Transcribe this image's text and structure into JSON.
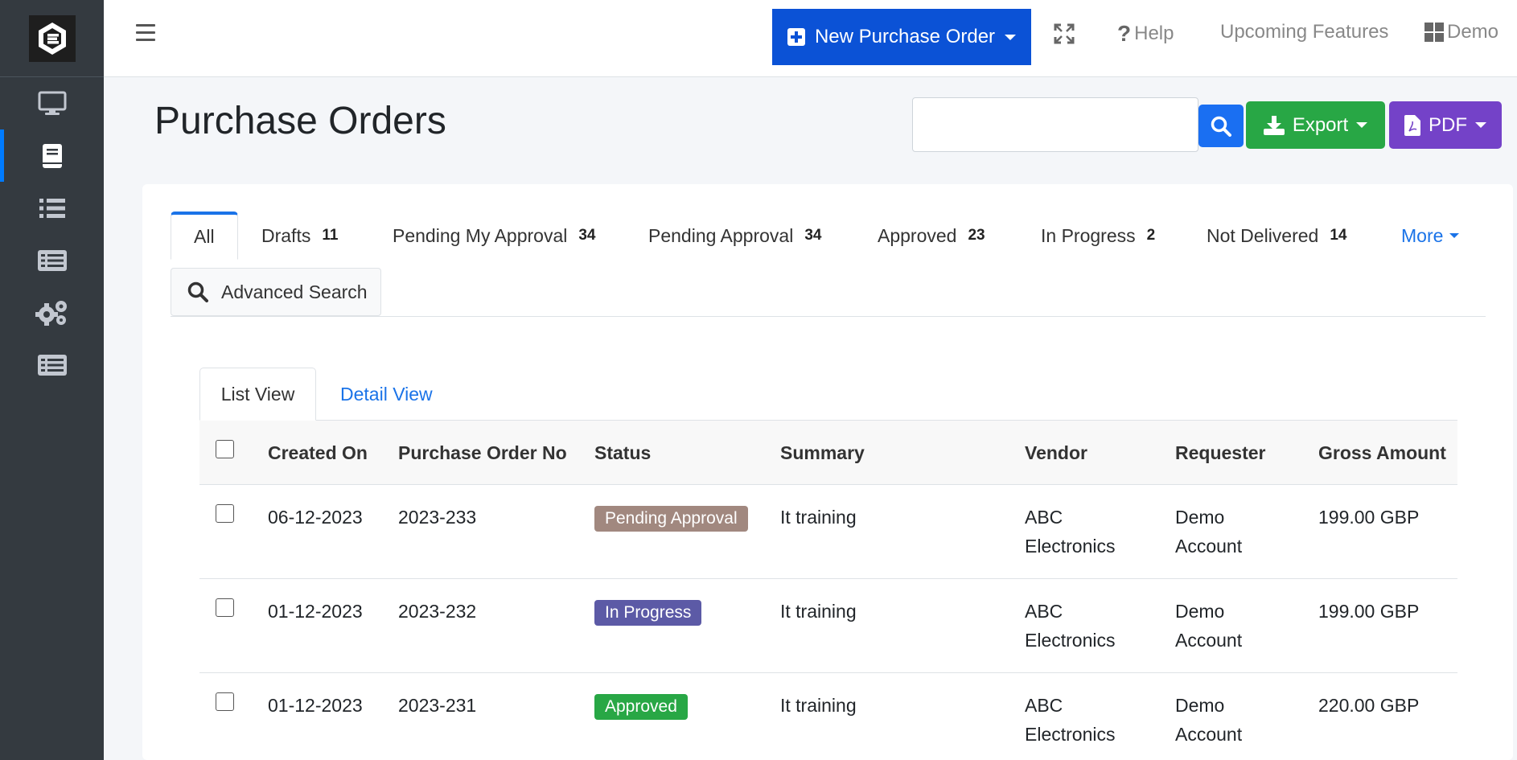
{
  "topbar": {
    "new_po_label": "New Purchase Order",
    "help_label": "Help",
    "upcoming_label": "Upcoming Features",
    "account_label": "Demo"
  },
  "header": {
    "title": "Purchase Orders",
    "search_value": "",
    "export_label": "Export",
    "pdf_label": "PDF"
  },
  "status_tabs": [
    {
      "label": "All",
      "count": ""
    },
    {
      "label": "Drafts",
      "count": "11"
    },
    {
      "label": "Pending My Approval",
      "count": "34"
    },
    {
      "label": "Pending Approval",
      "count": "34"
    },
    {
      "label": "Approved",
      "count": "23"
    },
    {
      "label": "In Progress",
      "count": "2"
    },
    {
      "label": "Not Delivered",
      "count": "14"
    }
  ],
  "more_label": "More",
  "advanced_search_label": "Advanced Search",
  "view_tabs": {
    "list": "List View",
    "detail": "Detail View"
  },
  "table": {
    "columns": [
      "Created On",
      "Purchase Order No",
      "Status",
      "Summary",
      "Vendor",
      "Requester",
      "Gross Amount"
    ],
    "rows": [
      {
        "created": "06-12-2023",
        "po_no": "2023-233",
        "status": "Pending Approval",
        "summary": "It training",
        "vendor_1": "ABC",
        "vendor_2": "Electronics",
        "req_1": "Demo",
        "req_2": "Account",
        "amount": "199.00 GBP"
      },
      {
        "created": "01-12-2023",
        "po_no": "2023-232",
        "status": "In Progress",
        "summary": "It training",
        "vendor_1": "ABC",
        "vendor_2": "Electronics",
        "req_1": "Demo",
        "req_2": "Account",
        "amount": "199.00 GBP"
      },
      {
        "created": "01-12-2023",
        "po_no": "2023-231",
        "status": "Approved",
        "summary": "It training",
        "vendor_1": "ABC",
        "vendor_2": "Electronics",
        "req_1": "Demo",
        "req_2": "Account",
        "amount": "220.00 GBP"
      }
    ]
  },
  "colors": {
    "primary": "#0b52d6",
    "export": "#28a745",
    "pdf": "#7442c8",
    "status_pending": "#a1887f",
    "status_in_progress": "#5c5aa6",
    "status_approved": "#28a745"
  }
}
